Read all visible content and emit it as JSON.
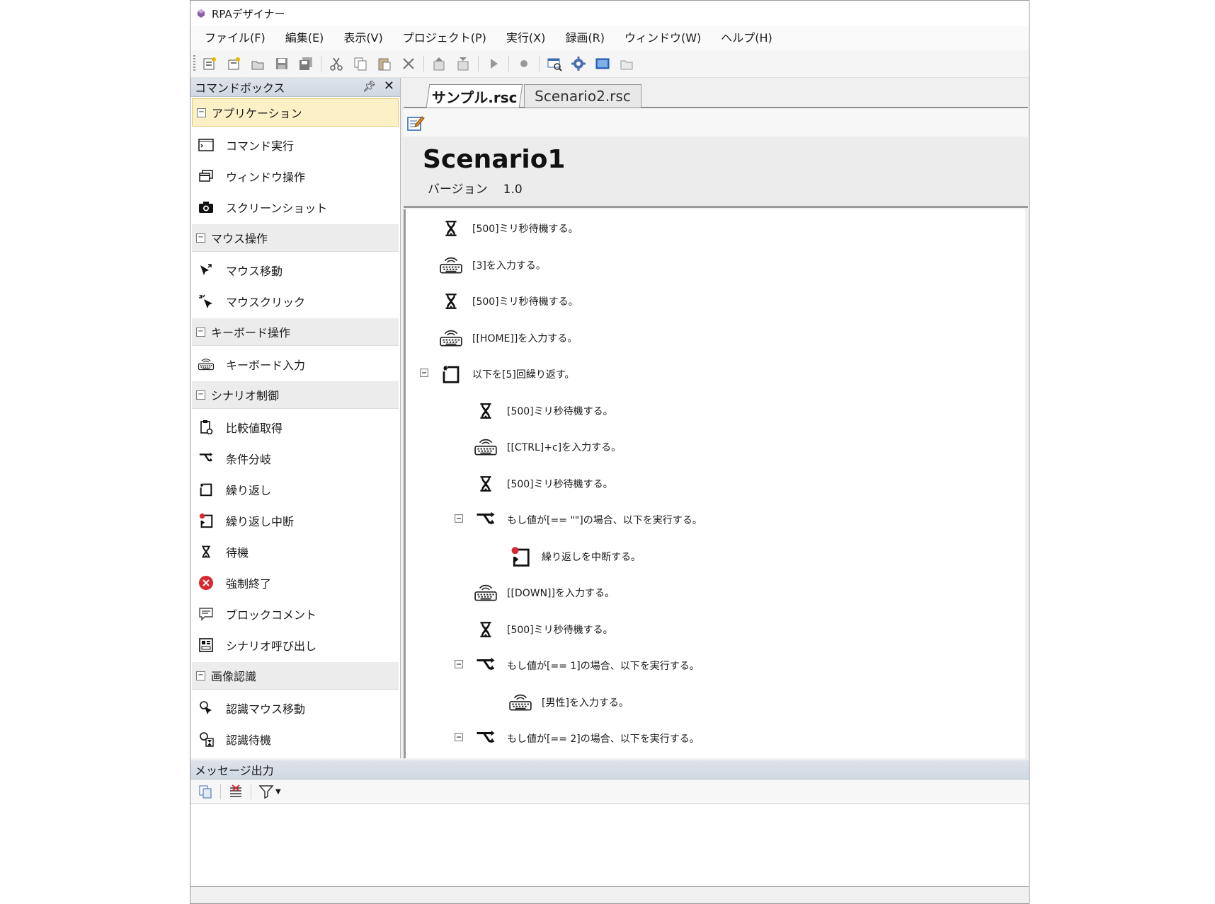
{
  "window": {
    "title": "RPAデザイナー"
  },
  "menu": [
    "ファイル(F)",
    "編集(E)",
    "表示(V)",
    "プロジェクト(P)",
    "実行(X)",
    "録画(R)",
    "ウィンドウ(W)",
    "ヘルプ(H)"
  ],
  "toolbar": {
    "icons": [
      "new-project-icon",
      "new-file-icon",
      "open-icon",
      "save-icon",
      "save-all-icon",
      "cut-icon",
      "copy-icon",
      "paste-icon",
      "delete-icon",
      "up-icon",
      "down-icon",
      "run-icon",
      "record-icon",
      "window-capture-icon",
      "settings-icon",
      "screen-icon",
      "folder-icon"
    ]
  },
  "command_box": {
    "title": "コマンドボックス",
    "categories": [
      {
        "label": "アプリケーション",
        "items": [
          "コマンド実行",
          "ウィンドウ操作",
          "スクリーンショット"
        ]
      },
      {
        "label": "マウス操作",
        "items": [
          "マウス移動",
          "マウスクリック"
        ]
      },
      {
        "label": "キーボード操作",
        "items": [
          "キーボード入力"
        ]
      },
      {
        "label": "シナリオ制御",
        "items": [
          "比較値取得",
          "条件分岐",
          "繰り返し",
          "繰り返し中断",
          "待機",
          "強制終了",
          "ブロックコメント",
          "シナリオ呼び出し"
        ]
      },
      {
        "label": "画像認識",
        "items": [
          "認識マウス移動",
          "認識待機"
        ]
      }
    ]
  },
  "tabs": [
    "サンプル.rsc",
    "Scenario2.rsc"
  ],
  "scenario": {
    "title": "Scenario1",
    "version_label": "バージョン",
    "version": "1.0",
    "steps": [
      "[500]ミリ秒待機する。",
      "[3]を入力する。",
      "[500]ミリ秒待機する。",
      "[[HOME]]を入力する。",
      "以下を[5]回繰り返す。",
      "[500]ミリ秒待機する。",
      "[[CTRL]+c]を入力する。",
      "[500]ミリ秒待機する。",
      "もし値が[== \"\"]の場合、以下を実行する。",
      "繰り返しを中断する。",
      "[[DOWN]]を入力する。",
      "[500]ミリ秒待機する。",
      "もし値が[== 1]の場合、以下を実行する。",
      "[男性]を入力する。",
      "もし値が[== 2]の場合、以下を実行する。"
    ]
  },
  "message_output": {
    "title": "メッセージ出力"
  },
  "colors": {
    "panel_header": "#cfd8e2",
    "selected_category": "#fcf1c6",
    "stop_red": "#d9282f"
  }
}
